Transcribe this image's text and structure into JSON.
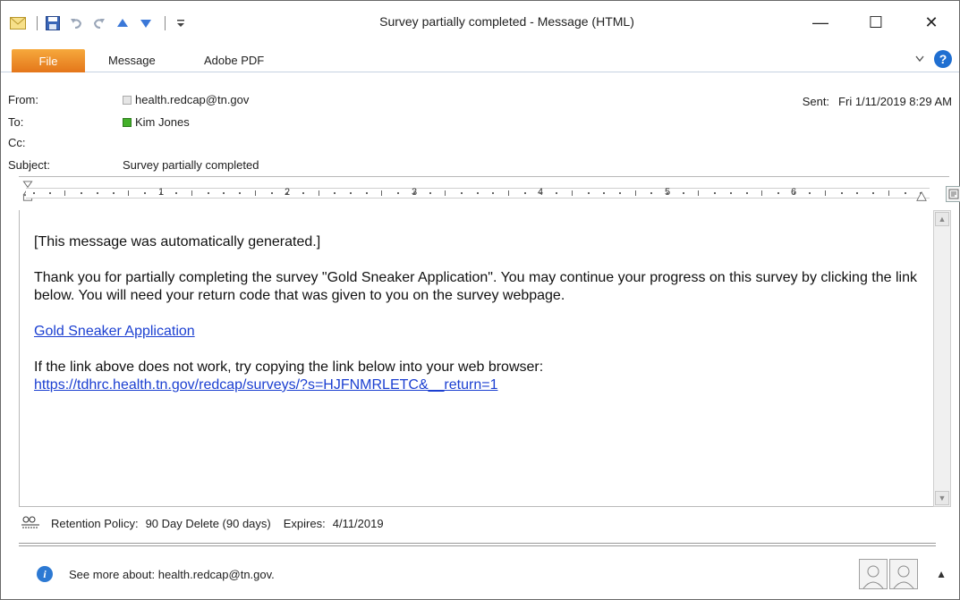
{
  "window": {
    "title": "Survey partially completed  -  Message (HTML)",
    "controls": {
      "minimize": "—",
      "maximize": "☐",
      "close": "✕"
    }
  },
  "ribbon": {
    "file_tab": "File",
    "tabs": [
      "Message",
      "Adobe PDF"
    ]
  },
  "header": {
    "from_label": "From:",
    "from_value": "health.redcap@tn.gov",
    "to_label": "To:",
    "to_value": "Kim Jones",
    "cc_label": "Cc:",
    "cc_value": "",
    "subject_label": "Subject:",
    "subject_value": "Survey partially completed",
    "sent_label": "Sent:",
    "sent_value": "Fri 1/11/2019 8:29 AM"
  },
  "ruler": {
    "numbers": [
      "1",
      "2",
      "3",
      "4",
      "5",
      "6"
    ]
  },
  "body": {
    "auto_line": "[This message was automatically generated.]",
    "paragraph": "Thank you for partially completing the survey \"Gold Sneaker Application\". You may continue your progress on this survey by clicking the link below. You will need your return code that was given to you on the survey webpage.",
    "survey_link": "Gold Sneaker Application",
    "fallback_text": "If the link above does not work, try copying the link below into your web browser:",
    "fallback_url": "https://tdhrc.health.tn.gov/redcap/surveys/?s=HJFNMRLETC&__return=1"
  },
  "retention": {
    "label": "Retention Policy:",
    "policy": "90 Day Delete (90 days)",
    "expires_label": "Expires:",
    "expires_value": "4/11/2019"
  },
  "people_pane": {
    "text": "See more about: health.redcap@tn.gov."
  },
  "colors": {
    "file_tab": "#e4761a",
    "link": "#1b3fd1",
    "presence_green": "#44b02a",
    "help_blue": "#1f6fd1"
  }
}
